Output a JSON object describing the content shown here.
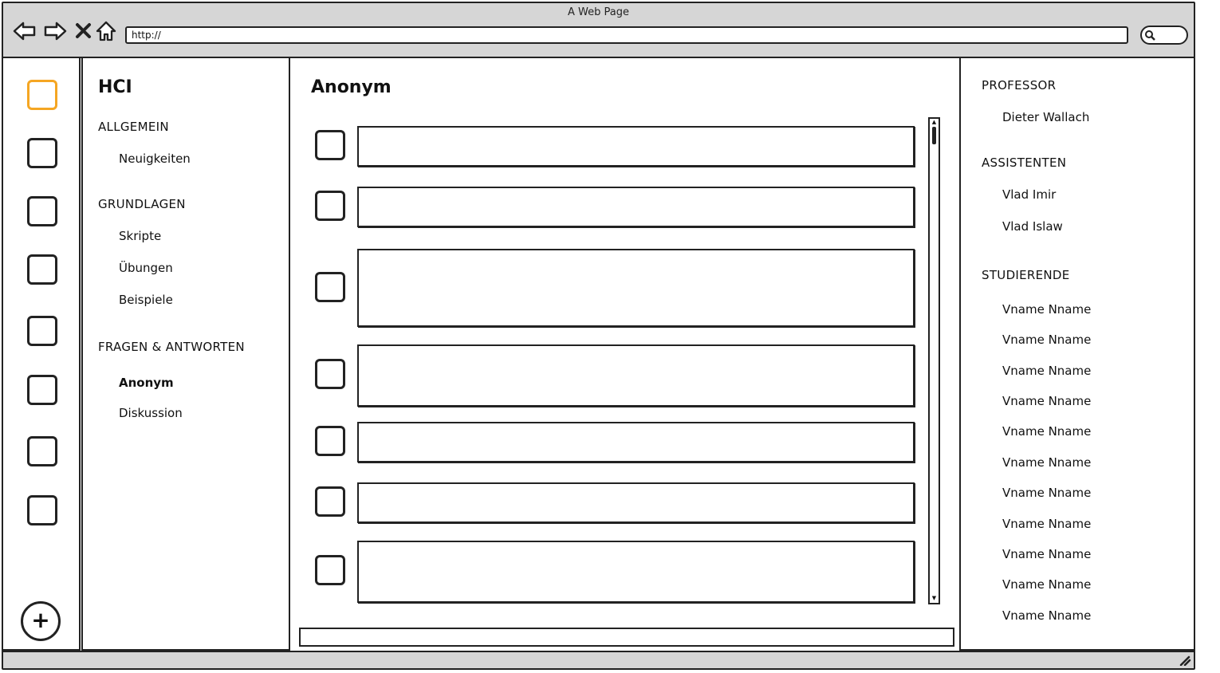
{
  "window": {
    "title": "A Web Page",
    "url": "http://"
  },
  "course": {
    "title": "HCI",
    "sections": [
      {
        "label": "ALLGEMEIN",
        "items": [
          "Neuigkeiten"
        ]
      },
      {
        "label": "GRUNDLAGEN",
        "items": [
          "Skripte",
          "Übungen",
          "Beispiele"
        ]
      },
      {
        "label": "FRAGEN & ANTWORTEN",
        "items": [
          "Anonym",
          "Diskussion"
        ]
      }
    ],
    "active_item": "Anonym"
  },
  "main": {
    "title": "Anonym"
  },
  "people": {
    "professor_label": "PROFESSOR",
    "professor": "Dieter Wallach",
    "assistants_label": "ASSISTENTEN",
    "assistants": [
      "Vlad Imir",
      "Vlad Islaw"
    ],
    "students_label": "STUDIERENDE",
    "students": [
      "Vname Nname",
      "Vname Nname",
      "Vname Nname",
      "Vname Nname",
      "Vname Nname",
      "Vname Nname",
      "Vname Nname",
      "Vname Nname",
      "Vname Nname",
      "Vname Nname",
      "Vname Nname"
    ]
  },
  "icons": {
    "add": "plus-icon",
    "back": "back-arrow-icon",
    "forward": "forward-arrow-icon",
    "stop": "close-icon",
    "home": "home-icon",
    "search": "search-icon",
    "resize": "resize-grip-icon"
  },
  "colors": {
    "active_accent": "#f5a623",
    "chrome": "#d6d6d6"
  }
}
